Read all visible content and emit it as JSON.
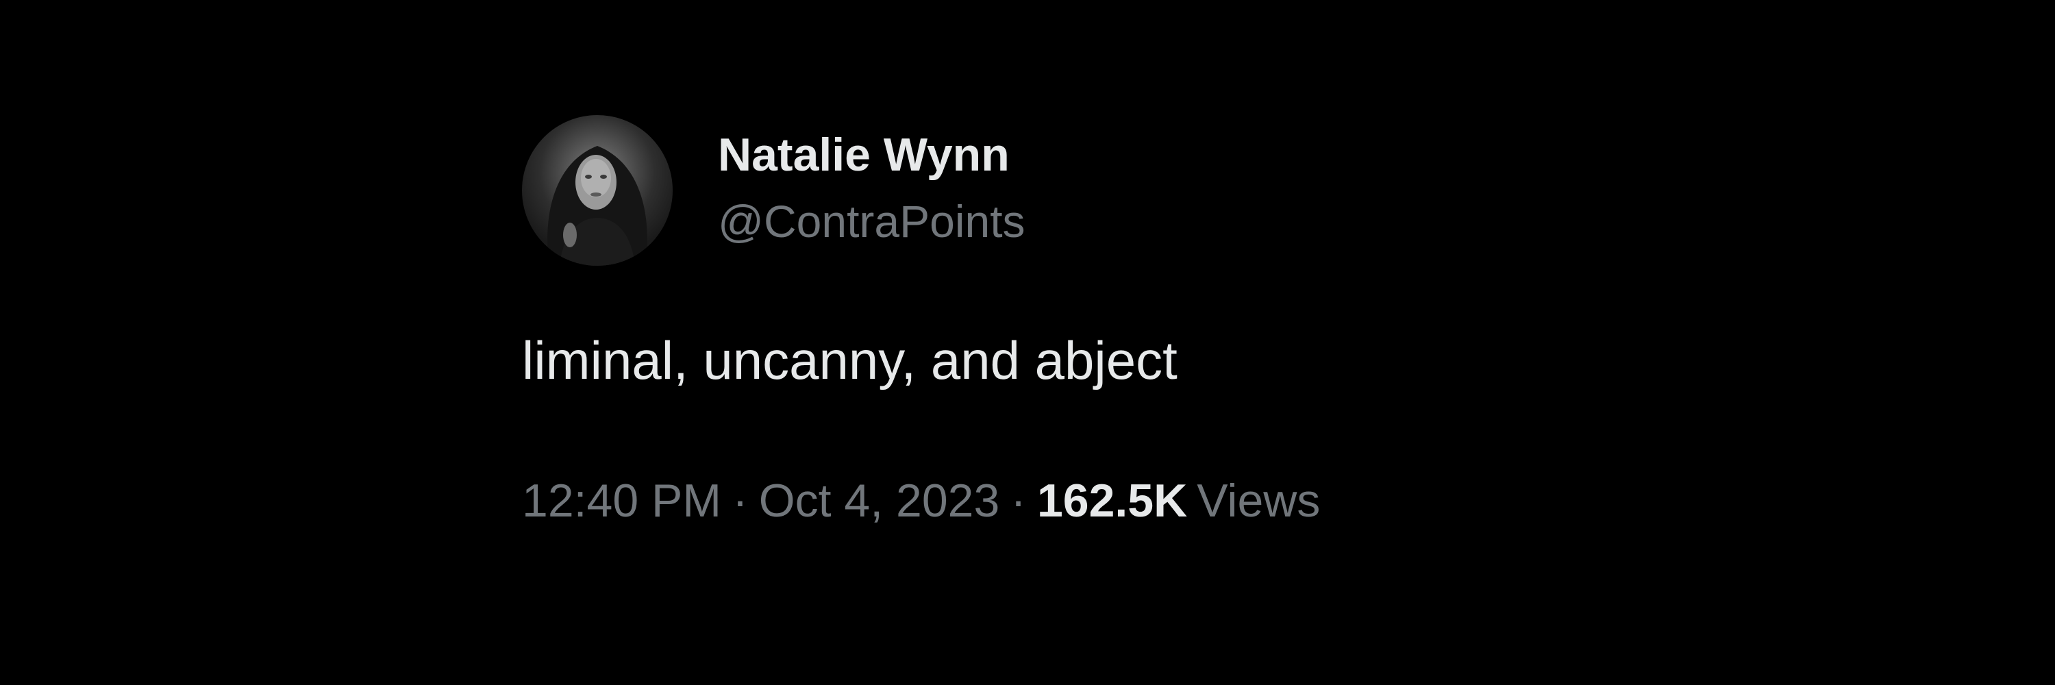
{
  "author": {
    "display_name": "Natalie Wynn",
    "handle": "@ContraPoints",
    "avatar_icon": "profile-photo"
  },
  "tweet": {
    "text": "liminal, uncanny, and abject"
  },
  "meta": {
    "time": "12:40 PM",
    "separator": "·",
    "date": "Oct 4, 2023",
    "views_count": "162.5K",
    "views_label": "Views"
  },
  "colors": {
    "background": "#000000",
    "primary_text": "#e7e9ea",
    "secondary_text": "#71767b"
  }
}
